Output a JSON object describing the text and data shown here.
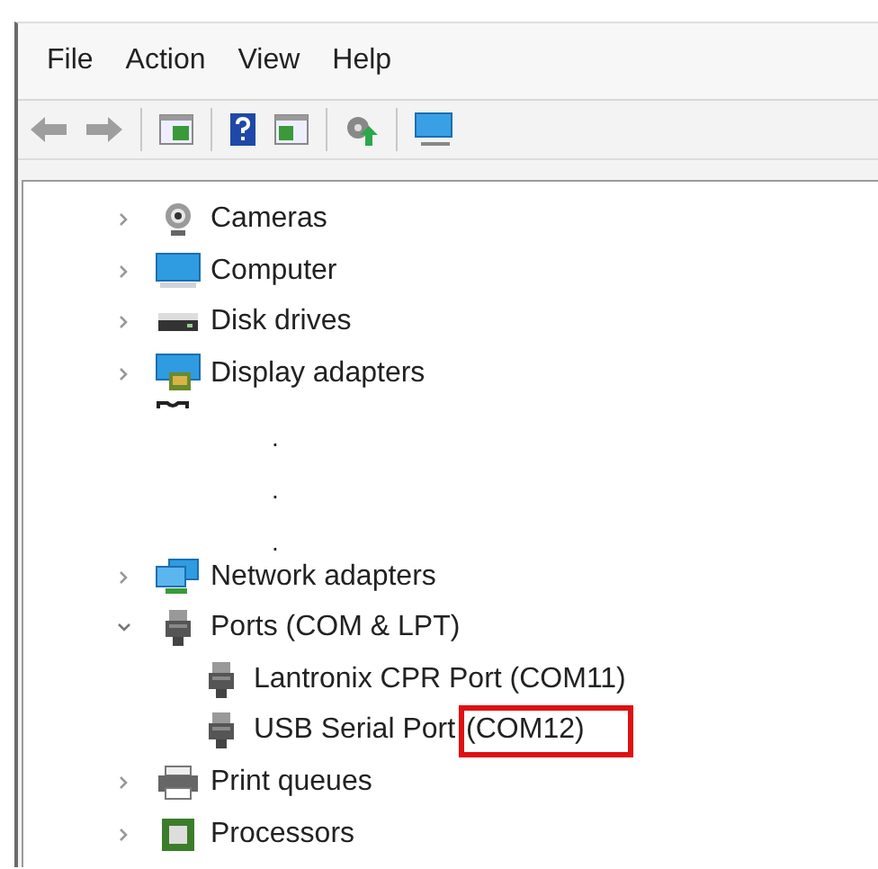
{
  "menu": [
    "File",
    "Action",
    "View",
    "Help"
  ],
  "toolbar": [
    {
      "kind": "back",
      "disabled": true
    },
    {
      "kind": "forward",
      "disabled": true
    },
    {
      "kind": "sep"
    },
    {
      "kind": "console"
    },
    {
      "kind": "sep"
    },
    {
      "kind": "help"
    },
    {
      "kind": "pane"
    },
    {
      "kind": "sep"
    },
    {
      "kind": "update"
    },
    {
      "kind": "sep"
    },
    {
      "kind": "monitor"
    }
  ],
  "tree": [
    {
      "kind": "camera",
      "label": "Cameras",
      "expanded": false
    },
    {
      "kind": "computer",
      "label": "Computer",
      "expanded": false
    },
    {
      "kind": "disk",
      "label": "Disk drives",
      "expanded": false
    },
    {
      "kind": "display",
      "label": "Display adapters",
      "expanded": false
    },
    {
      "kind": "gap",
      "dots": [
        ".",
        ".",
        "."
      ]
    },
    {
      "kind": "network",
      "label": "Network adapters",
      "expanded": false
    },
    {
      "kind": "port",
      "label": "Ports (COM & LPT)",
      "expanded": true,
      "children": [
        {
          "kind": "port",
          "label": "Lantronix CPR Port (COM11)"
        },
        {
          "kind": "port",
          "label": "USB Serial Port",
          "highlighted": "(COM12)"
        }
      ]
    },
    {
      "kind": "printer",
      "label": "Print queues",
      "expanded": false
    },
    {
      "kind": "processor",
      "label": "Processors",
      "expanded": false
    }
  ]
}
